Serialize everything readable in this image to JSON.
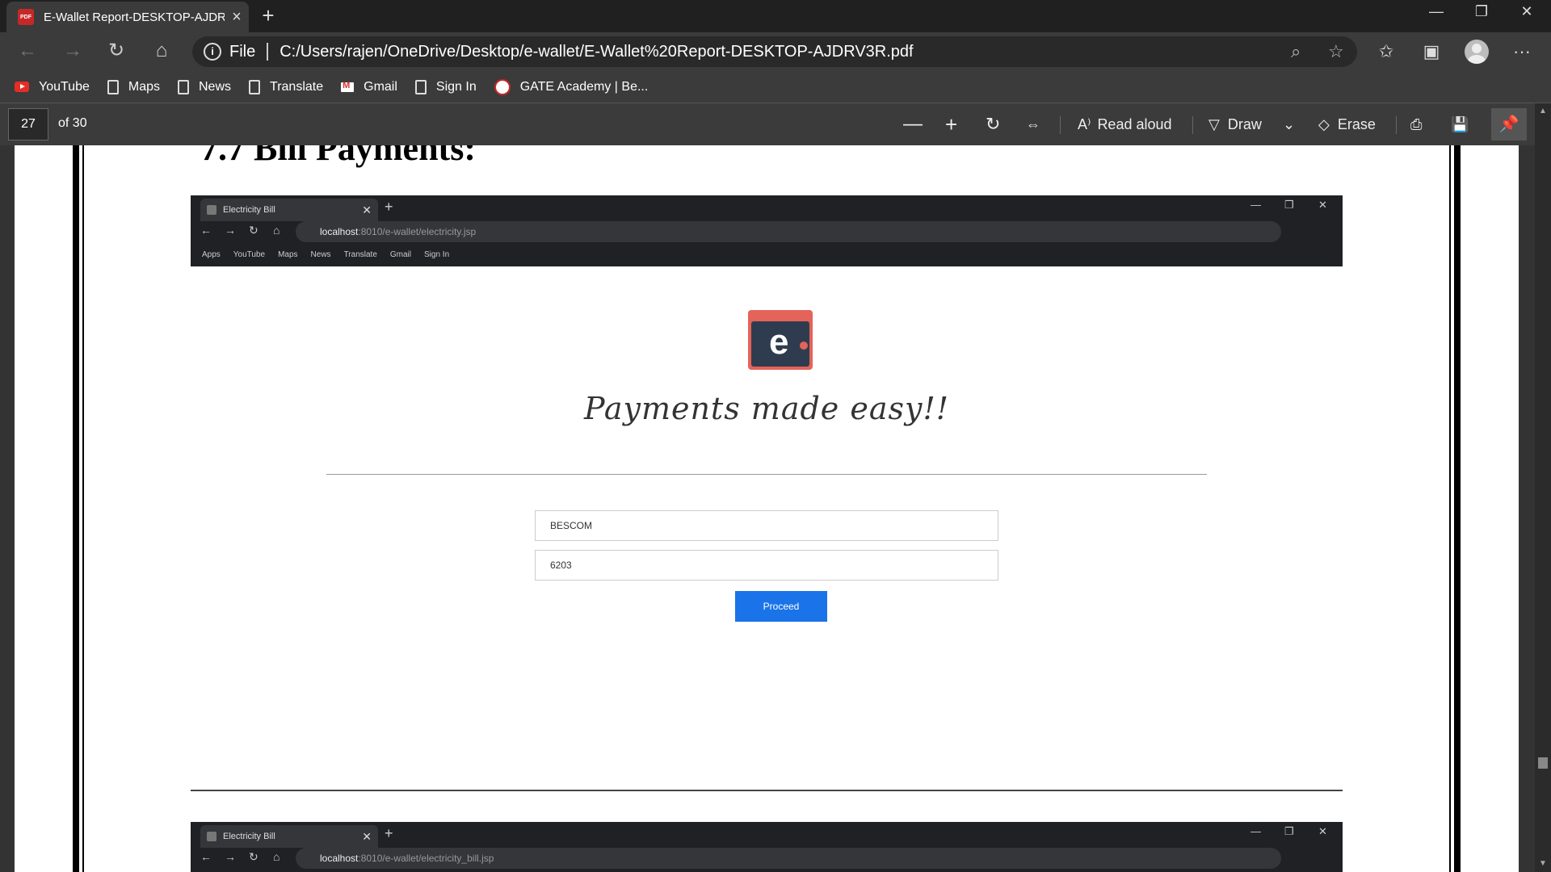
{
  "browser": {
    "tab_title": "E-Wallet Report-DESKTOP-AJDRV3R.pdf",
    "tab_label": "PDF",
    "file_label": "File",
    "url": "C:/Users/rajen/OneDrive/Desktop/e-wallet/E-Wallet%20Report-DESKTOP-AJDRV3R.pdf",
    "bookmarks": [
      "YouTube",
      "Maps",
      "News",
      "Translate",
      "Gmail",
      "Sign In",
      "GATE Academy | Be..."
    ]
  },
  "pdf_toolbar": {
    "page_number": "27",
    "page_total": "of 30",
    "read_aloud": "Read aloud",
    "draw": "Draw",
    "erase": "Erase"
  },
  "document": {
    "heading": "7.7 Bill Payments:",
    "screenshot1": {
      "tab_title": "Electricity Bill",
      "url_host": "localhost",
      "url_path": ":8010/e-wallet/electricity.jsp",
      "bookmarks": [
        "Apps",
        "YouTube",
        "Maps",
        "News",
        "Translate",
        "Gmail",
        "Sign In"
      ],
      "logo_letter": "e",
      "slogan": "Payments made easy!!",
      "input1_value": "BESCOM",
      "input2_value": "6203",
      "proceed_label": "Proceed"
    },
    "screenshot2": {
      "tab_title": "Electricity Bill",
      "url_host": "localhost",
      "url_path": ":8010/e-wallet/electricity_bill.jsp"
    }
  }
}
